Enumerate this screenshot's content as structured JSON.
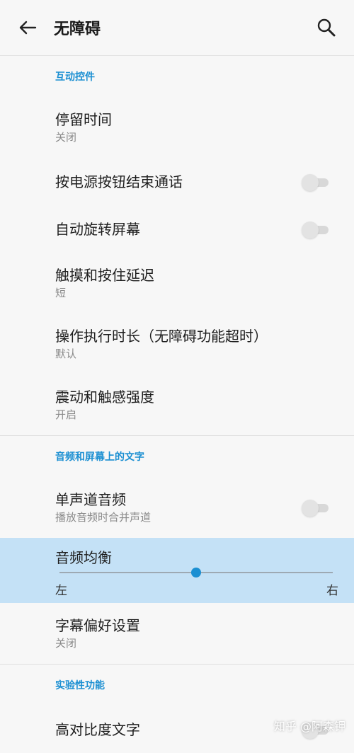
{
  "app_bar": {
    "title": "无障碍"
  },
  "sections": {
    "interaction": {
      "header": "互动控件"
    },
    "audio": {
      "header": "音频和屏幕上的文字"
    },
    "experimental": {
      "header": "实验性功能"
    }
  },
  "items": {
    "dwell_time": {
      "label": "停留时间",
      "sub": "关闭"
    },
    "power_end_call": {
      "label": "按电源按钮结束通话",
      "toggle": "off"
    },
    "auto_rotate": {
      "label": "自动旋转屏幕",
      "toggle": "off"
    },
    "touch_hold_delay": {
      "label": "触摸和按住延迟",
      "sub": "短"
    },
    "action_timeout": {
      "label": "操作执行时长（无障碍功能超时）",
      "sub": "默认"
    },
    "vibration": {
      "label": "震动和触感强度",
      "sub": "开启"
    },
    "mono_audio": {
      "label": "单声道音频",
      "sub": "播放音频时合并声道",
      "toggle": "off"
    },
    "audio_balance": {
      "label": "音频均衡",
      "left": "左",
      "right": "右",
      "value": 0.5
    },
    "caption_prefs": {
      "label": "字幕偏好设置",
      "sub": "关闭"
    },
    "high_contrast_text": {
      "label": "高对比度文字",
      "toggle": "off"
    }
  },
  "watermark": "知乎 @阿森钾",
  "colors": {
    "accent": "#1b8fd2",
    "highlight": "#c4e1f6",
    "background": "#f7f7f7"
  },
  "icons": {
    "back": "arrow-left-icon",
    "search": "search-icon"
  }
}
